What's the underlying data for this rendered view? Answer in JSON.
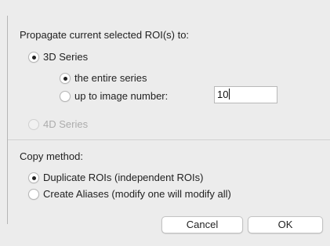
{
  "dialog": {
    "propagate_label": "Propagate current selected ROI(s) to:",
    "series_3d": {
      "label": "3D Series",
      "selected": true
    },
    "entire_series": {
      "label": "the entire series",
      "selected": true
    },
    "up_to_image": {
      "label": "up to image number:",
      "selected": false
    },
    "image_number_value": "10",
    "series_4d": {
      "label": "4D Series",
      "selected": false,
      "enabled": false
    },
    "copy_method_label": "Copy method:",
    "duplicate_rois": {
      "label": "Duplicate ROIs (independent ROIs)",
      "selected": true
    },
    "create_aliases": {
      "label": "Create Aliases (modify one will modify all)",
      "selected": false
    },
    "cancel_label": "Cancel",
    "ok_label": "OK"
  }
}
